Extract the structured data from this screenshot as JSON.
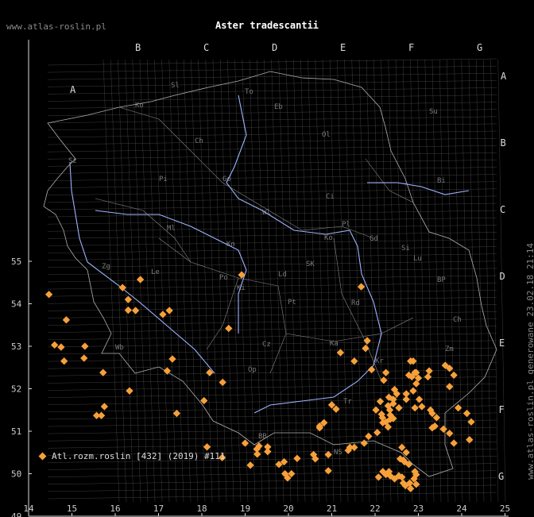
{
  "header": {
    "site": "www.atlas-roslin.pl",
    "title": "Aster tradescantii",
    "generated": "www.atlas-roslin.pl generowane 23.02.18 21:14"
  },
  "legend": {
    "label": "Atl.rozm.roslin [432] (2019) #111"
  },
  "colors": {
    "marker": "#f7a03a",
    "grid": "#8c8c8c",
    "river": "#9fb3ff",
    "border": "#b0b0b0"
  },
  "chart_data": {
    "type": "scatter",
    "title": "Aster tradescantii",
    "xlim": [
      14,
      25
    ],
    "ylim": [
      49,
      55.5
    ],
    "x_ticks": [
      "14",
      "15",
      "16",
      "17",
      "18",
      "19",
      "20",
      "21",
      "22",
      "23",
      "24",
      "25"
    ],
    "y_ticks": [
      "49",
      "50",
      "51",
      "52",
      "53",
      "54",
      "55"
    ],
    "grid_letters": {
      "top": [
        "B",
        "C",
        "D",
        "E",
        "F",
        "G"
      ],
      "upper_left": [
        "A"
      ],
      "right": [
        "A",
        "B",
        "C",
        "D",
        "E",
        "F",
        "G"
      ]
    },
    "region_labels": [
      "Sl",
      "Ko",
      "Ch",
      "Pi",
      "Go",
      "Sz",
      "Zg",
      "Le",
      "Wb",
      "Po",
      "Kn",
      "Ld",
      "Pt",
      "Cz",
      "Op",
      "Ka",
      "Ki",
      "Rd",
      "Lu",
      "Ch",
      "Zm",
      "Bi",
      "Ci",
      "Ol",
      "Eb",
      "Su",
      "To",
      "Wl",
      "SK",
      "Pl",
      "Si",
      "BP",
      "Tr",
      "BB",
      "NS",
      "Pr",
      "Kr",
      "Gd",
      "Ko",
      "Ml"
    ],
    "series": [
      {
        "name": "Atl.rozm.roslin [432] (2019) #111",
        "points": [
          [
            14.47,
            54.22
          ],
          [
            14.87,
            53.62
          ],
          [
            14.6,
            53.03
          ],
          [
            14.75,
            52.98
          ],
          [
            14.82,
            52.65
          ],
          [
            15.3,
            53.0
          ],
          [
            15.28,
            52.72
          ],
          [
            15.72,
            52.38
          ],
          [
            16.33,
            51.95
          ],
          [
            15.75,
            51.58
          ],
          [
            15.57,
            51.37
          ],
          [
            15.68,
            51.37
          ],
          [
            16.17,
            54.38
          ],
          [
            16.3,
            54.1
          ],
          [
            16.3,
            53.85
          ],
          [
            16.47,
            53.84
          ],
          [
            16.58,
            54.57
          ],
          [
            17.1,
            53.75
          ],
          [
            17.25,
            53.84
          ],
          [
            17.2,
            52.42
          ],
          [
            17.32,
            52.7
          ],
          [
            17.42,
            51.42
          ],
          [
            18.18,
            52.38
          ],
          [
            18.05,
            51.72
          ],
          [
            18.48,
            52.15
          ],
          [
            18.12,
            50.63
          ],
          [
            18.62,
            53.42
          ],
          [
            18.47,
            50.38
          ],
          [
            18.92,
            54.68
          ],
          [
            19.0,
            50.72
          ],
          [
            19.12,
            50.2
          ],
          [
            19.27,
            50.58
          ],
          [
            19.28,
            50.46
          ],
          [
            19.32,
            50.65
          ],
          [
            19.52,
            50.63
          ],
          [
            19.52,
            50.52
          ],
          [
            19.78,
            50.22
          ],
          [
            19.9,
            50.28
          ],
          [
            19.92,
            50.0
          ],
          [
            19.98,
            49.9
          ],
          [
            20.07,
            50.0
          ],
          [
            20.2,
            50.36
          ],
          [
            20.58,
            50.45
          ],
          [
            20.62,
            50.35
          ],
          [
            20.72,
            51.12
          ],
          [
            20.82,
            51.2
          ],
          [
            20.72,
            51.08
          ],
          [
            20.92,
            50.45
          ],
          [
            20.92,
            50.07
          ],
          [
            21.0,
            51.62
          ],
          [
            21.1,
            51.52
          ],
          [
            21.2,
            52.85
          ],
          [
            21.52,
            52.65
          ],
          [
            21.38,
            50.55
          ],
          [
            21.42,
            50.62
          ],
          [
            21.52,
            50.62
          ],
          [
            21.68,
            54.4
          ],
          [
            21.78,
            52.95
          ],
          [
            21.82,
            53.13
          ],
          [
            21.75,
            50.72
          ],
          [
            21.85,
            50.88
          ],
          [
            21.92,
            52.45
          ],
          [
            22.02,
            51.5
          ],
          [
            22.05,
            50.97
          ],
          [
            22.12,
            51.7
          ],
          [
            22.15,
            51.4
          ],
          [
            22.17,
            51.32
          ],
          [
            22.18,
            51.2
          ],
          [
            22.25,
            51.22
          ],
          [
            22.3,
            51.1
          ],
          [
            22.32,
            51.8
          ],
          [
            22.3,
            51.6
          ],
          [
            22.34,
            51.5
          ],
          [
            22.35,
            51.38
          ],
          [
            22.35,
            51.28
          ],
          [
            22.42,
            51.3
          ],
          [
            22.42,
            51.75
          ],
          [
            22.42,
            51.65
          ],
          [
            22.5,
            51.88
          ],
          [
            22.2,
            52.2
          ],
          [
            22.25,
            52.38
          ],
          [
            22.45,
            51.98
          ],
          [
            22.55,
            51.55
          ],
          [
            22.62,
            50.62
          ],
          [
            22.58,
            50.35
          ],
          [
            22.65,
            50.32
          ],
          [
            22.68,
            50.28
          ],
          [
            22.72,
            50.5
          ],
          [
            22.78,
            50.22
          ],
          [
            22.78,
            52.32
          ],
          [
            22.82,
            52.65
          ],
          [
            22.88,
            52.65
          ],
          [
            22.92,
            52.38
          ],
          [
            22.85,
            52.28
          ],
          [
            22.95,
            52.38
          ],
          [
            22.95,
            52.12
          ],
          [
            22.88,
            51.95
          ],
          [
            23.0,
            52.25
          ],
          [
            23.08,
            51.58
          ],
          [
            22.92,
            51.55
          ],
          [
            22.72,
            51.75
          ],
          [
            22.72,
            51.88
          ],
          [
            23.02,
            51.75
          ],
          [
            23.22,
            52.28
          ],
          [
            23.25,
            52.42
          ],
          [
            23.28,
            51.5
          ],
          [
            23.32,
            51.42
          ],
          [
            23.32,
            51.08
          ],
          [
            23.38,
            51.12
          ],
          [
            23.42,
            51.32
          ],
          [
            23.58,
            51.05
          ],
          [
            23.62,
            52.55
          ],
          [
            23.72,
            52.48
          ],
          [
            23.82,
            52.32
          ],
          [
            23.72,
            52.05
          ],
          [
            23.82,
            50.72
          ],
          [
            23.72,
            50.95
          ],
          [
            23.92,
            51.55
          ],
          [
            24.12,
            51.42
          ],
          [
            24.18,
            50.8
          ],
          [
            24.22,
            51.22
          ],
          [
            22.8,
            49.78
          ],
          [
            22.7,
            49.72
          ],
          [
            22.65,
            49.78
          ],
          [
            22.62,
            49.92
          ],
          [
            22.55,
            49.95
          ],
          [
            22.45,
            49.88
          ],
          [
            22.32,
            50.05
          ],
          [
            22.35,
            49.95
          ],
          [
            22.25,
            49.98
          ],
          [
            22.18,
            50.05
          ],
          [
            22.08,
            49.92
          ],
          [
            22.82,
            49.65
          ],
          [
            22.95,
            49.75
          ],
          [
            22.9,
            49.88
          ],
          [
            22.92,
            50.05
          ],
          [
            22.95,
            49.98
          ]
        ]
      }
    ]
  }
}
